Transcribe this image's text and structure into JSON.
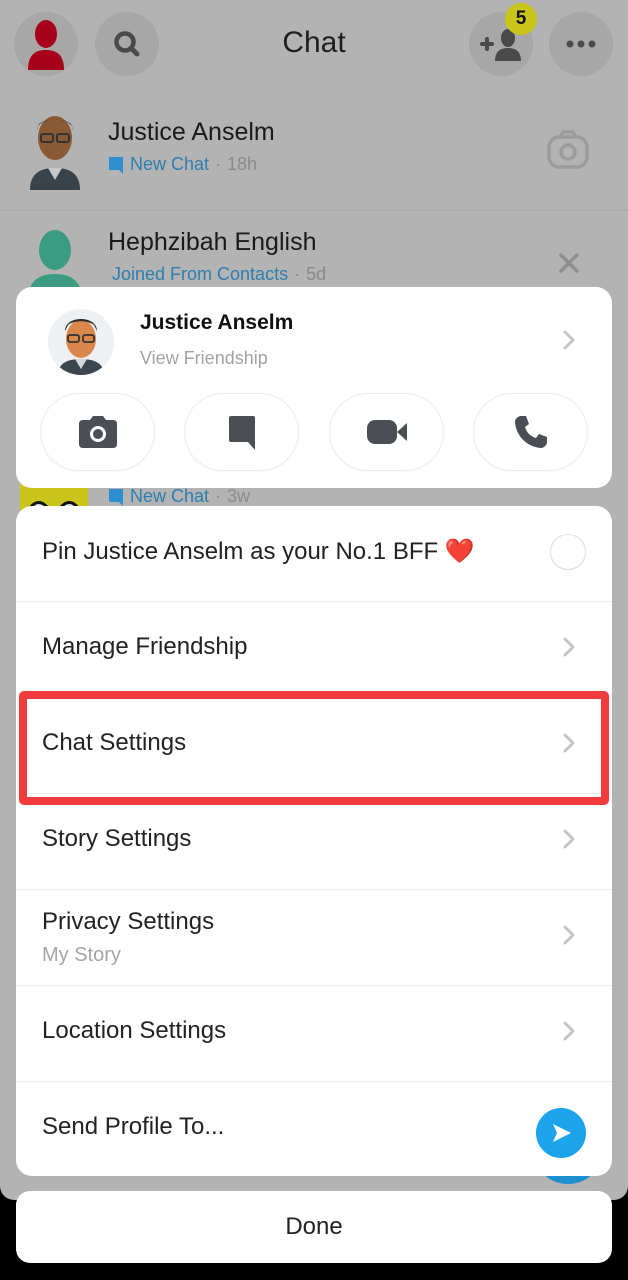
{
  "header": {
    "title": "Chat",
    "friend_requests_badge": "5",
    "icons": [
      "profile-avatar-icon",
      "search-icon",
      "add-friend-icon",
      "more-icon"
    ]
  },
  "chat_list": [
    {
      "name": "Justice Anselm",
      "status": "New Chat",
      "time": "18h",
      "status_icon": "chat-bubble-icon",
      "action_icon": "camera-icon"
    },
    {
      "name": "Hephzibah English",
      "status": "Joined From Contacts",
      "time": "5d",
      "action_icon": "close-icon"
    },
    {
      "status": "New Chat",
      "time": "3w",
      "status_icon": "chat-bubble-icon"
    }
  ],
  "profile_card": {
    "name": "Justice Anselm",
    "subtitle": "View Friendship",
    "actions": [
      {
        "name": "camera",
        "icon": "camera-icon"
      },
      {
        "name": "chat",
        "icon": "chat-bubble-icon"
      },
      {
        "name": "video-call",
        "icon": "video-camera-icon"
      },
      {
        "name": "voice-call",
        "icon": "phone-icon"
      }
    ]
  },
  "menu": {
    "items": [
      {
        "label": "Pin Justice Anselm as your No.1 BFF ❤️",
        "control": "radio",
        "checked": false
      },
      {
        "label": "Manage Friendship",
        "control": "chevron"
      },
      {
        "label": "Chat Settings",
        "control": "chevron",
        "highlighted": true
      },
      {
        "label": "Story Settings",
        "control": "chevron"
      },
      {
        "label": "Privacy Settings",
        "sublabel": "My Story",
        "control": "chevron"
      },
      {
        "label": "Location Settings",
        "control": "chevron"
      },
      {
        "label": "Send Profile To...",
        "control": "send-button"
      }
    ]
  },
  "done_label": "Done",
  "colors": {
    "accent_blue": "#1ca3ec",
    "highlight_red": "#f23b3d",
    "badge_yellow": "#c9c51a",
    "status_blue": "#2d7fb0",
    "overlay_gray": "#b3b3b3"
  }
}
